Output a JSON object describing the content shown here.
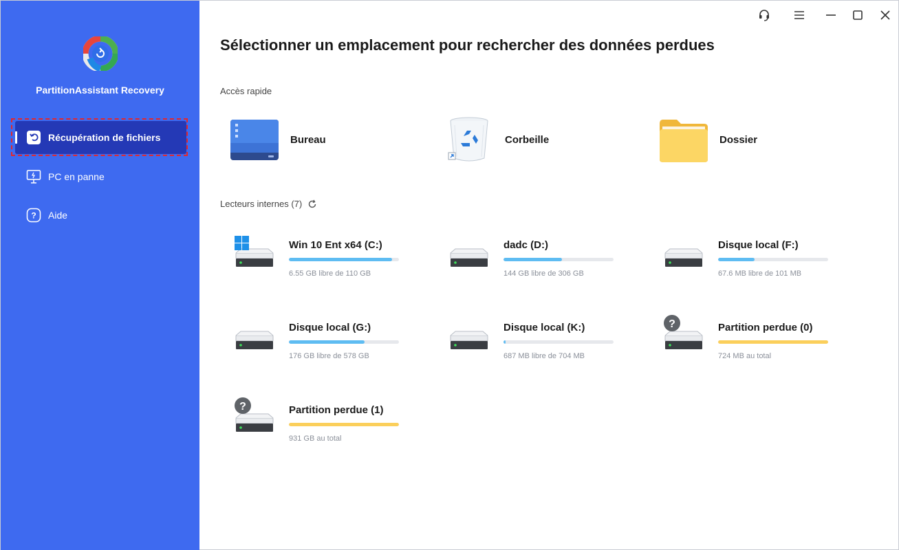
{
  "app": {
    "name": "PartitionAssistant Recovery"
  },
  "sidebar": {
    "items": [
      {
        "label": "Récupération de fichiers",
        "icon": "file-restore-icon",
        "active": true
      },
      {
        "label": "PC en panne",
        "icon": "monitor-crash-icon",
        "active": false
      },
      {
        "label": "Aide",
        "icon": "help-circle-icon",
        "active": false
      }
    ]
  },
  "titlebar": {
    "buttons": [
      "headset-support-icon",
      "menu-icon",
      "minimize-icon",
      "maximize-icon",
      "close-icon"
    ]
  },
  "main": {
    "title": "Sélectionner un emplacement pour rechercher des données perdues",
    "quick_access": {
      "label": "Accès rapide",
      "items": [
        {
          "label": "Bureau",
          "icon": "desktop-icon"
        },
        {
          "label": "Corbeille",
          "icon": "recycle-bin-icon"
        },
        {
          "label": "Dossier",
          "icon": "folder-icon"
        }
      ]
    },
    "drives_section": {
      "label": "Lecteurs internes (7)",
      "drives": [
        {
          "name": "Win 10 Ent x64 (C:)",
          "info": "6.55 GB libre de 110 GB",
          "used_fraction": 0.94,
          "type": "system"
        },
        {
          "name": "dadc (D:)",
          "info": "144 GB libre de 306 GB",
          "used_fraction": 0.53,
          "type": "disk"
        },
        {
          "name": "Disque local (F:)",
          "info": "67.6 MB libre de 101 MB",
          "used_fraction": 0.33,
          "type": "disk"
        },
        {
          "name": "Disque local (G:)",
          "info": "176 GB libre de 578 GB",
          "used_fraction": 0.69,
          "type": "disk"
        },
        {
          "name": "Disque local (K:)",
          "info": "687 MB libre de 704 MB",
          "used_fraction": 0.02,
          "type": "disk"
        },
        {
          "name": "Partition perdue (0)",
          "info": "724 MB au total",
          "used_fraction": 1.0,
          "type": "lost"
        },
        {
          "name": "Partition perdue (1)",
          "info": "931 GB au total",
          "used_fraction": 1.0,
          "type": "lost"
        }
      ]
    }
  },
  "colors": {
    "sidebar_bg": "#3e6af0",
    "sidebar_active": "#2439b6",
    "bar_used": "#5ebcf2",
    "bar_lost": "#fbcf5b"
  }
}
